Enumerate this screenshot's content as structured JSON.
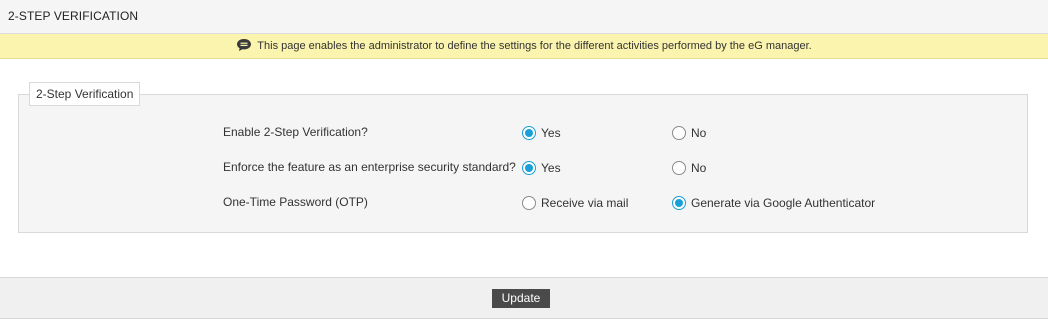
{
  "header": {
    "title": "2-STEP VERIFICATION"
  },
  "info_bar": {
    "icon": "speech-bubble-icon",
    "text": "This page enables the administrator to define the settings for the different activities performed by the eG manager."
  },
  "section": {
    "legend": "2-Step Verification",
    "rows": [
      {
        "label": "Enable 2-Step Verification?",
        "options": [
          {
            "label": "Yes",
            "selected": true
          },
          {
            "label": "No",
            "selected": false
          }
        ]
      },
      {
        "label": "Enforce the feature as an enterprise security standard?",
        "options": [
          {
            "label": "Yes",
            "selected": true
          },
          {
            "label": "No",
            "selected": false
          }
        ]
      },
      {
        "label": "One-Time Password (OTP)",
        "options": [
          {
            "label": "Receive via mail",
            "selected": false
          },
          {
            "label": "Generate via Google Authenticator",
            "selected": true
          }
        ]
      }
    ]
  },
  "footer": {
    "update_label": "Update"
  },
  "colors": {
    "accent": "#1a9fd6",
    "info_bar_bg": "#fbf4ae",
    "button_bg": "#4a4a4a"
  }
}
